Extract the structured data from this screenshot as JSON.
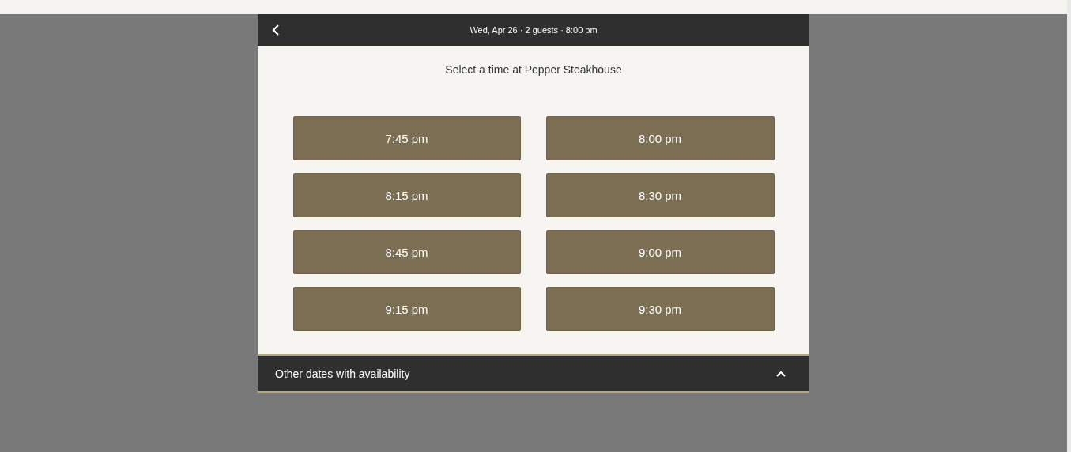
{
  "header": {
    "summary": "Wed, Apr 26 · 2 guests · 8:00 pm"
  },
  "title": "Select a time at Pepper Steakhouse",
  "times": [
    "7:45 pm",
    "8:00 pm",
    "8:15 pm",
    "8:30 pm",
    "8:45 pm",
    "9:00 pm",
    "9:15 pm",
    "9:30 pm"
  ],
  "footer": {
    "label": "Other dates with availability",
    "expanded": false
  }
}
